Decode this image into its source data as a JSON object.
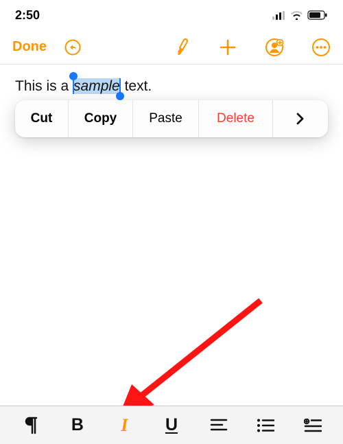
{
  "status": {
    "time": "2:50"
  },
  "toolbar": {
    "done_label": "Done"
  },
  "document": {
    "text_before": "This is a ",
    "selected_word": "sample",
    "text_after": " text."
  },
  "context_menu": {
    "cut": "Cut",
    "copy": "Copy",
    "paste": "Paste",
    "delete": "Delete"
  },
  "format_bar": {
    "bold": "B",
    "italic": "I",
    "underline": "U"
  }
}
